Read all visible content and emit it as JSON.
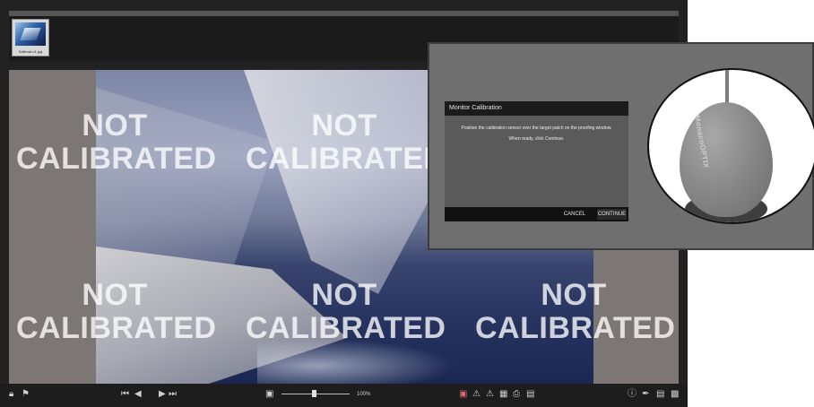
{
  "thumbnail": {
    "caption": "Sailboat-v1.jpg"
  },
  "watermark": {
    "line1": "NOT",
    "line2": "CALIBRATED"
  },
  "toolbar": {
    "zoom_value": 0.45,
    "zoom_label": "100%"
  },
  "dialog": {
    "title": "Monitor Calibration",
    "message_line1": "Position the calibration sensor over the target patch on the proofing window.",
    "message_line2": "When ready, click Continue.",
    "cancel_label": "CANCEL",
    "continue_label": "CONTINUE"
  },
  "sensor": {
    "brand": "MonacoOPTIX"
  },
  "icons": {
    "lock": "lock-icon",
    "flag": "flag-icon",
    "first": "first-page-icon",
    "prev": "previous-icon",
    "next": "next-icon",
    "last": "last-page-icon",
    "fit": "fit-to-window-icon",
    "monitor": "monitor-icon",
    "warning": "gamut-warning-icon",
    "print": "print-icon",
    "info": "info-icon",
    "eyedropper": "eyedropper-icon",
    "notes": "notes-icon"
  }
}
